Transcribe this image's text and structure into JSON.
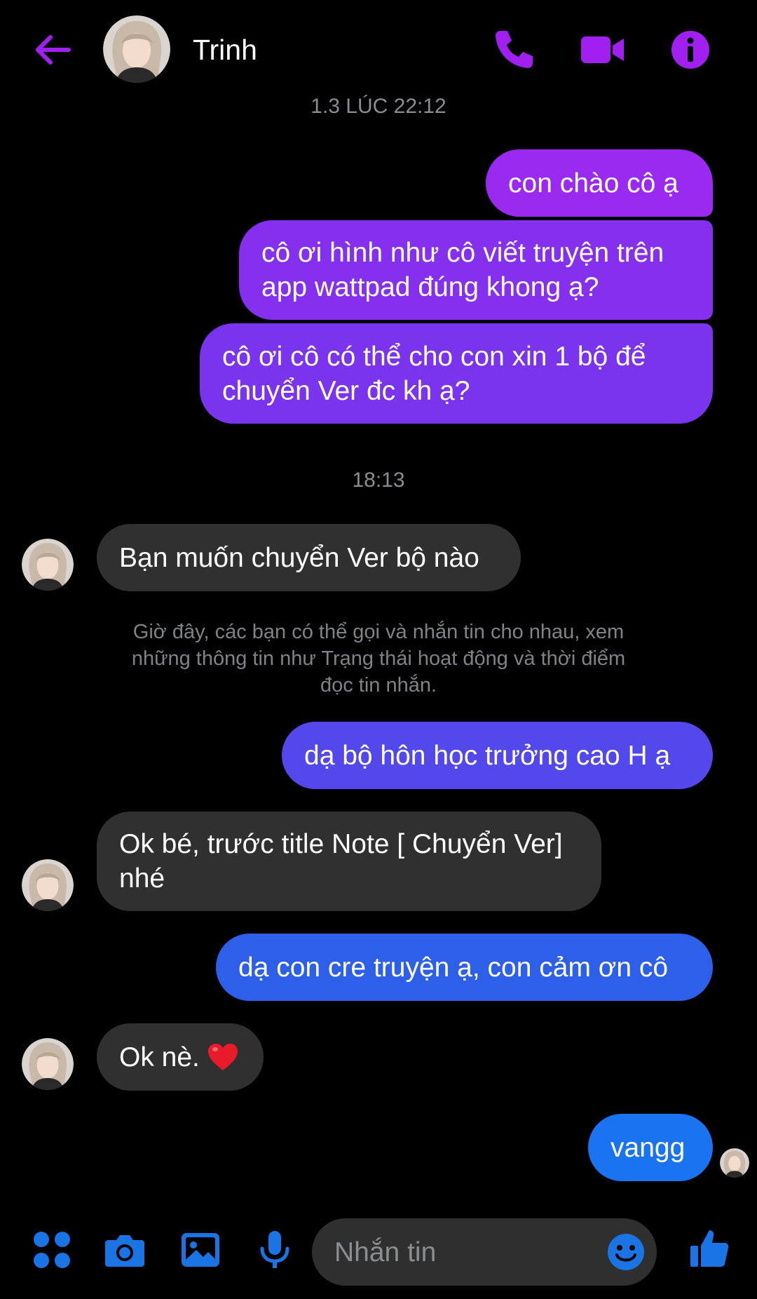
{
  "header": {
    "contact_name": "Trinh"
  },
  "messages": {
    "timestamp_1": "1.3 LÚC 22:12",
    "out_1": "con chào cô ạ",
    "out_2_line1": "cô ơi hình như  cô viết truyện trên",
    "out_2_line2": "app wattpad đúng khong ạ?",
    "out_3_line1": "cô ơi cô có thể cho con xin 1 bộ để",
    "out_3_line2": "chuyển Ver đc kh ạ?",
    "timestamp_2": "18:13",
    "in_1": "Bạn muốn chuyển Ver bộ nào",
    "system_note_line1": "Giờ đây, các bạn có thể gọi và nhắn tin cho nhau, xem",
    "system_note_line2": "những thông tin như Trạng thái hoạt động và thời điểm",
    "system_note_line3": "đọc tin nhắn.",
    "out_4": "dạ bộ hôn học trưởng cao H ạ",
    "in_2_line1": "Ok bé, trước title Note [ Chuyển Ver]",
    "in_2_line2": "nhé",
    "out_5": "dạ con cre truyện ạ, con cảm ơn cô",
    "in_3": "Ok nè.",
    "out_6": "vangg"
  },
  "composer": {
    "placeholder": "Nhắn tin"
  },
  "colors": {
    "accent_purple": "#a020f0",
    "bubble_out_top": "#9b2af0",
    "bubble_out_mid": "#7b34ee",
    "bubble_out_blue": "#2e5fe8",
    "bubble_out_bottom": "#1a73f0",
    "bubble_in": "#303030",
    "composer_icon_blue": "#1b74e4",
    "background": "#000000"
  },
  "icons": {
    "back": "arrow-left-icon",
    "call": "phone-icon",
    "video": "video-camera-icon",
    "info": "info-icon",
    "apps": "four-dots-icon",
    "camera": "camera-icon",
    "gallery": "image-icon",
    "mic": "microphone-icon",
    "emoji": "smiley-icon",
    "like": "thumbs-up-icon",
    "heart": "red-heart-emoji"
  }
}
